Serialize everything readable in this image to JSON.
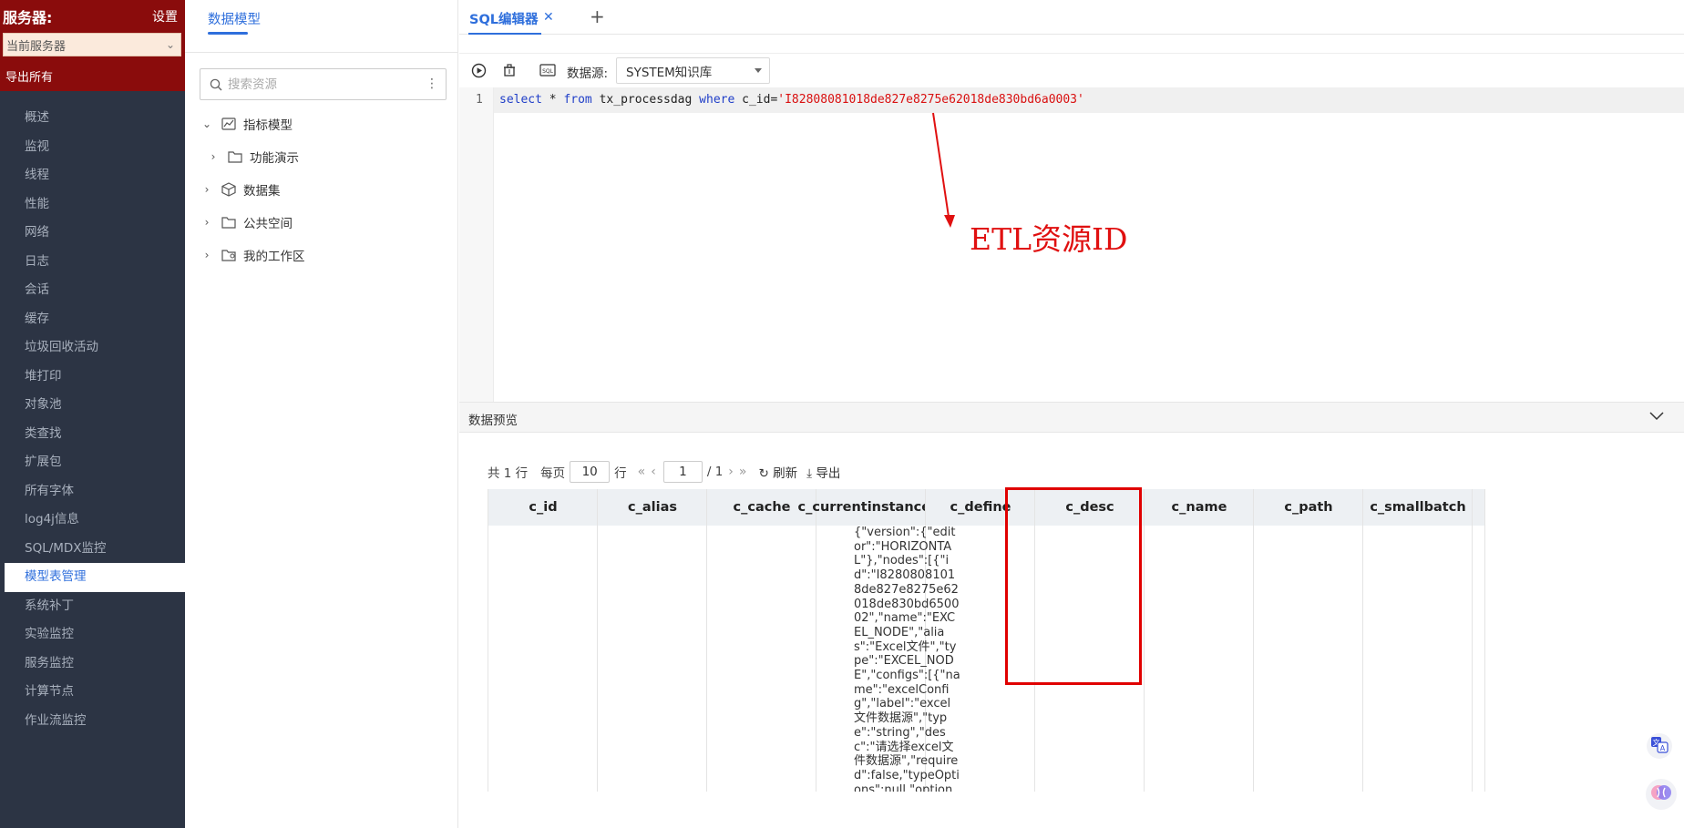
{
  "sidebar": {
    "title": "服务器:",
    "settings_label": "设置",
    "server_select_value": "当前服务器",
    "export_all_label": "导出所有",
    "items": [
      {
        "label": "概述"
      },
      {
        "label": "监视"
      },
      {
        "label": "线程"
      },
      {
        "label": "性能"
      },
      {
        "label": "网络"
      },
      {
        "label": "日志"
      },
      {
        "label": "会话"
      },
      {
        "label": "缓存"
      },
      {
        "label": "垃圾回收活动"
      },
      {
        "label": "堆打印"
      },
      {
        "label": "对象池"
      },
      {
        "label": "类查找"
      },
      {
        "label": "扩展包"
      },
      {
        "label": "所有字体"
      },
      {
        "label": "log4j信息"
      },
      {
        "label": "SQL/MDX监控"
      },
      {
        "label": "模型表管理"
      },
      {
        "label": "系统补丁"
      },
      {
        "label": "实验监控"
      },
      {
        "label": "服务监控"
      },
      {
        "label": "计算节点"
      },
      {
        "label": "作业流监控"
      }
    ],
    "active_index": 16,
    "colors": {
      "header_bg": "#8a0c0c",
      "nav_bg": "#2c3444",
      "active_text": "#2f6fdc"
    }
  },
  "model_panel": {
    "tab_label": "数据模型",
    "search_placeholder": "搜索资源",
    "more_icon": "more-vertical-icon",
    "tree": [
      {
        "label": "指标模型",
        "expanded": true,
        "icon": "metric-model-icon"
      },
      {
        "label": "功能演示",
        "expanded": false,
        "icon": "folder-icon",
        "child": true
      },
      {
        "label": "数据集",
        "expanded": false,
        "icon": "cube-icon"
      },
      {
        "label": "公共空间",
        "expanded": false,
        "icon": "folder-icon"
      },
      {
        "label": "我的工作区",
        "expanded": false,
        "icon": "workspace-folder-icon"
      }
    ]
  },
  "editor": {
    "tab_label": "SQL编辑器",
    "datasource_label": "数据源:",
    "datasource_value": "SYSTEM知识库",
    "line_number": "1",
    "sql": {
      "kw_select": "select",
      "star": " * ",
      "kw_from": "from",
      "table": " tx_processdag ",
      "kw_where": "where",
      "cond": " c_id=",
      "value": "'I82808081018de827e8275e62018de830bd6a0003'"
    },
    "annotation": "ETL资源ID"
  },
  "preview": {
    "title": "数据预览",
    "pager": {
      "total_text": "共 1 行",
      "per_page_label": "每页",
      "per_page_value": "10",
      "row_unit": "行",
      "page_value": "1",
      "page_total": "/ 1",
      "refresh_label": "刷新",
      "export_label": "导出"
    },
    "columns": [
      "c_id",
      "c_alias",
      "c_cache",
      "c_currentinstanceid",
      "c_define",
      "c_desc",
      "c_name",
      "c_path",
      "c_smallbatch"
    ],
    "cell_define": "{\"version\":{\"editor\":\"HORIZONTAL\"},\"nodes\":[{\"id\":\"I82808081018de827e8275e62018de830bd650002\",\"name\":\"EXCEL_NODE\",\"alias\":\"Excel文件\",\"type\":\"EXCEL_NODE\",\"configs\":[{\"name\":\"excelConfig\",\"label\":\"excel文件数据源\",\"type\":\"string\",\"desc\":\"请选择excel文件数据源\",\"required\":false,\"typeOptions\":null,\"options\":null,\"va"
  },
  "floating": {
    "translate_icon": "translate-icon",
    "ai_icon": "ai-brain-icon"
  },
  "accent_color": "#2f6fdc",
  "highlight_color": "#e00000"
}
